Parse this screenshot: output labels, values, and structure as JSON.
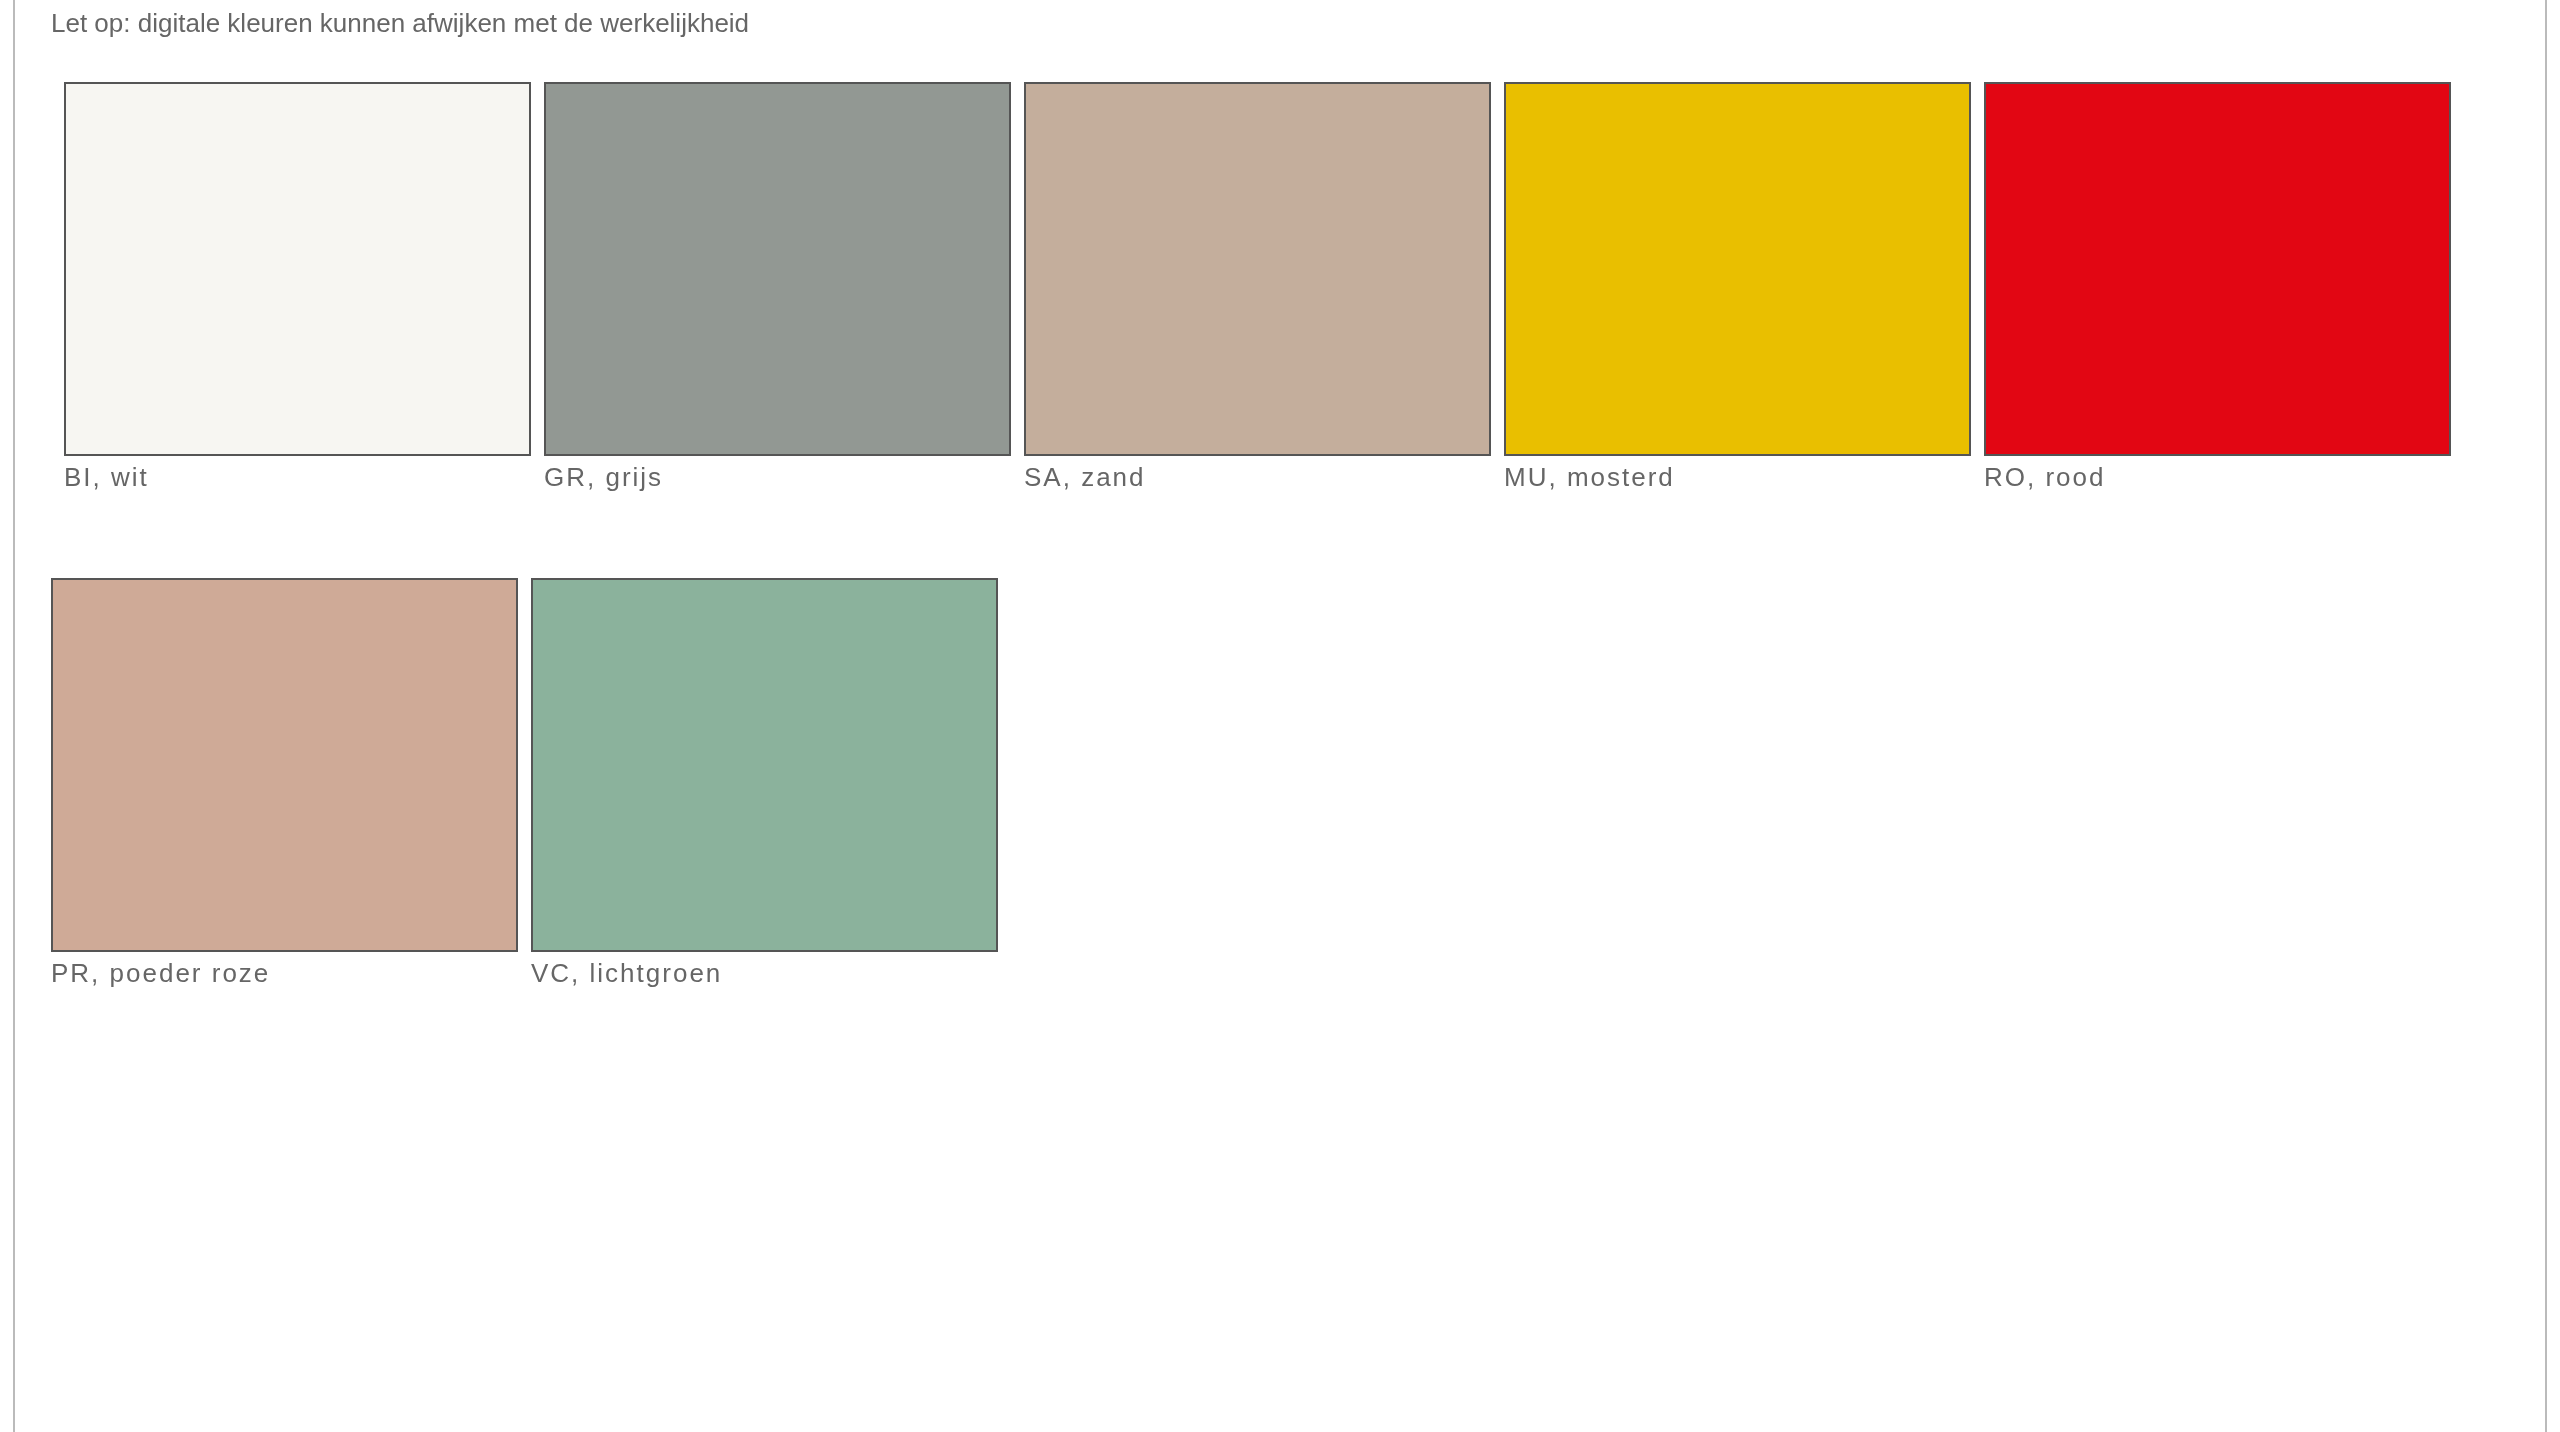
{
  "notice": "Let op: digitale kleuren kunnen afwijken met de werkelijkheid",
  "rows": [
    {
      "swatches": [
        {
          "label": "BI, wit",
          "color": "#f7f6f2"
        },
        {
          "label": "GR, grijs",
          "color": "#929893"
        },
        {
          "label": "SA, zand",
          "color": "#c4ae9c"
        },
        {
          "label": "MU, mosterd",
          "color": "#e9bf00"
        },
        {
          "label": "RO, rood",
          "color": "#e20613"
        }
      ]
    },
    {
      "swatches": [
        {
          "label": "PR, poeder roze",
          "color": "#cfaa97"
        },
        {
          "label": "VC, lichtgroen",
          "color": "#8bb29c"
        }
      ]
    }
  ]
}
